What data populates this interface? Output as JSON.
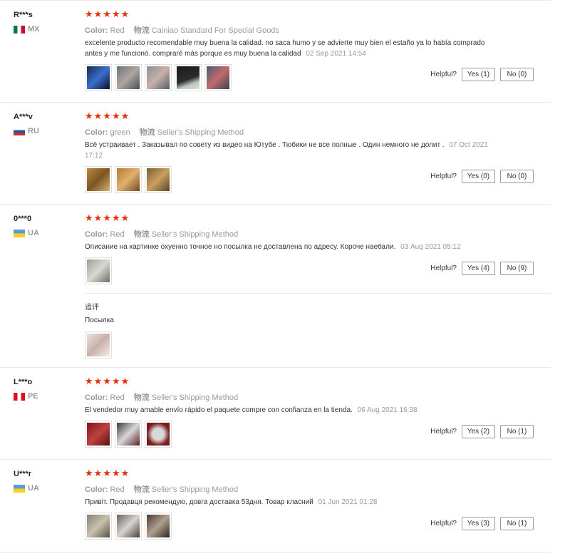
{
  "labels": {
    "color": "Color:",
    "shipping": "物流",
    "helpful": "Helpful?",
    "followup_title": "追评"
  },
  "reviews": [
    {
      "user": "R***s",
      "country": "MX",
      "stars": "★★★★★",
      "color": "Red",
      "shipping": "Cainiao Standard For Special Goods",
      "text": "excelente producto recomendable muy buena la calidad. no saca humo y se advierte muy bien el estaño ya lo había comprado antes y me funcionó. compraré más porque es muy buena la calidad",
      "date": "02 Sep 2021 14:54",
      "yes": "Yes (1)",
      "no": "No (0)"
    },
    {
      "user": "A***v",
      "country": "RU",
      "stars": "★★★★★",
      "color": "green",
      "shipping": "Seller's Shipping Method",
      "text": "Всё устраивает . Заказывал по совету из видео на Ютубе . Тюбики не все полные . Один немного не долит .",
      "date": "07 Oct 2021 17:12",
      "yes": "Yes (0)",
      "no": "No (0)"
    },
    {
      "user": "0***0",
      "country": "UA",
      "stars": "★★★★★",
      "color": "Red",
      "shipping": "Seller's Shipping Method",
      "text": "Описание на картинке охуенно точное но посылка не доставлена по адресу. Короче наебали.",
      "date": "03 Aug 2021 05:12",
      "yes": "Yes (4)",
      "no": "No (9)",
      "followup_text": "Посылка"
    },
    {
      "user": "L***o",
      "country": "PE",
      "stars": "★★★★★",
      "color": "Red",
      "shipping": "Seller's Shipping Method",
      "text": "El vendedor muy amable envío rápido el paquete compre con confianza en la tienda.",
      "date": "06 Aug 2021 16:38",
      "yes": "Yes (2)",
      "no": "No (1)"
    },
    {
      "user": "U***r",
      "country": "UA",
      "stars": "★★★★★",
      "color": "Red",
      "shipping": "Seller's Shipping Method",
      "text": "Привіт. Продавця рекомендую, довга доставка 53дня. Товар класний",
      "date": "01 Jun 2021 01:28",
      "yes": "Yes (3)",
      "no": "No (1)"
    }
  ]
}
